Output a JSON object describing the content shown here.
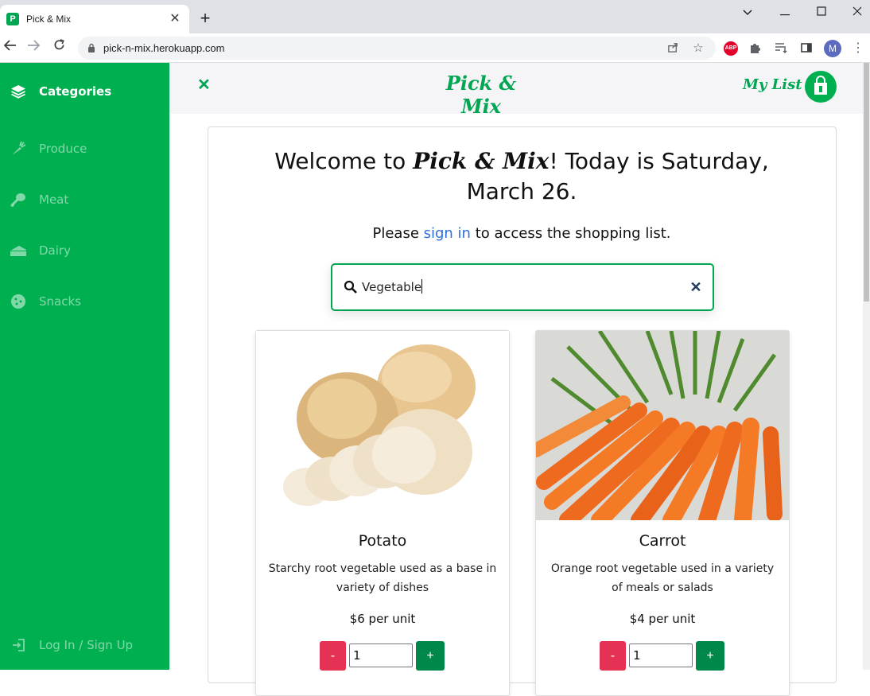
{
  "browser": {
    "tab_title": "Pick & Mix",
    "tab_favicon": "P",
    "url": "pick-n-mix.herokuapp.com",
    "profile_initial": "M",
    "abp_label": "ABP"
  },
  "sidebar": {
    "header": "Categories",
    "items": [
      {
        "label": "Produce",
        "icon": "carrot-icon"
      },
      {
        "label": "Meat",
        "icon": "drumstick-icon"
      },
      {
        "label": "Dairy",
        "icon": "cheese-icon"
      },
      {
        "label": "Snacks",
        "icon": "cookie-icon"
      }
    ],
    "footer": "Log In / Sign Up"
  },
  "topbar": {
    "brand": "Pick & Mix",
    "my_list": "My List"
  },
  "welcome": {
    "prefix": "Welcome to ",
    "brand": "Pick & Mix",
    "suffix": "! Today is Saturday, March 26."
  },
  "signin": {
    "before": "Please ",
    "link": "sign in",
    "after": " to access the shopping list."
  },
  "search": {
    "value": "Vegetable"
  },
  "products": [
    {
      "name": "Potato",
      "description": "Starchy root vegetable used as a base in variety of dishes",
      "price": "$6 per unit",
      "quantity": "1",
      "minus": "-",
      "plus": "+"
    },
    {
      "name": "Carrot",
      "description": "Orange root vegetable used in a variety of meals or salads",
      "price": "$4 per unit",
      "quantity": "1",
      "minus": "-",
      "plus": "+"
    }
  ],
  "colors": {
    "brand_green": "#00a651",
    "sidebar_green": "#00b050",
    "minus_red": "#e53154",
    "plus_green": "#00874a",
    "link_blue": "#2f6fd6"
  }
}
